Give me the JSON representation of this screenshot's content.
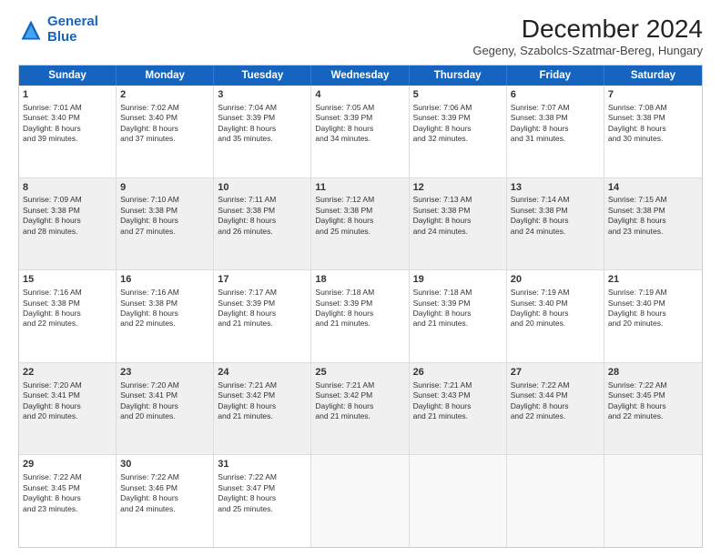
{
  "logo": {
    "line1": "General",
    "line2": "Blue"
  },
  "title": "December 2024",
  "subtitle": "Gegeny, Szabolcs-Szatmar-Bereg, Hungary",
  "header_days": [
    "Sunday",
    "Monday",
    "Tuesday",
    "Wednesday",
    "Thursday",
    "Friday",
    "Saturday"
  ],
  "rows": [
    [
      {
        "day": "1",
        "text": "Sunrise: 7:01 AM\nSunset: 3:40 PM\nDaylight: 8 hours\nand 39 minutes.",
        "shade": false
      },
      {
        "day": "2",
        "text": "Sunrise: 7:02 AM\nSunset: 3:40 PM\nDaylight: 8 hours\nand 37 minutes.",
        "shade": false
      },
      {
        "day": "3",
        "text": "Sunrise: 7:04 AM\nSunset: 3:39 PM\nDaylight: 8 hours\nand 35 minutes.",
        "shade": false
      },
      {
        "day": "4",
        "text": "Sunrise: 7:05 AM\nSunset: 3:39 PM\nDaylight: 8 hours\nand 34 minutes.",
        "shade": false
      },
      {
        "day": "5",
        "text": "Sunrise: 7:06 AM\nSunset: 3:39 PM\nDaylight: 8 hours\nand 32 minutes.",
        "shade": false
      },
      {
        "day": "6",
        "text": "Sunrise: 7:07 AM\nSunset: 3:38 PM\nDaylight: 8 hours\nand 31 minutes.",
        "shade": false
      },
      {
        "day": "7",
        "text": "Sunrise: 7:08 AM\nSunset: 3:38 PM\nDaylight: 8 hours\nand 30 minutes.",
        "shade": false
      }
    ],
    [
      {
        "day": "8",
        "text": "Sunrise: 7:09 AM\nSunset: 3:38 PM\nDaylight: 8 hours\nand 28 minutes.",
        "shade": true
      },
      {
        "day": "9",
        "text": "Sunrise: 7:10 AM\nSunset: 3:38 PM\nDaylight: 8 hours\nand 27 minutes.",
        "shade": true
      },
      {
        "day": "10",
        "text": "Sunrise: 7:11 AM\nSunset: 3:38 PM\nDaylight: 8 hours\nand 26 minutes.",
        "shade": true
      },
      {
        "day": "11",
        "text": "Sunrise: 7:12 AM\nSunset: 3:38 PM\nDaylight: 8 hours\nand 25 minutes.",
        "shade": true
      },
      {
        "day": "12",
        "text": "Sunrise: 7:13 AM\nSunset: 3:38 PM\nDaylight: 8 hours\nand 24 minutes.",
        "shade": true
      },
      {
        "day": "13",
        "text": "Sunrise: 7:14 AM\nSunset: 3:38 PM\nDaylight: 8 hours\nand 24 minutes.",
        "shade": true
      },
      {
        "day": "14",
        "text": "Sunrise: 7:15 AM\nSunset: 3:38 PM\nDaylight: 8 hours\nand 23 minutes.",
        "shade": true
      }
    ],
    [
      {
        "day": "15",
        "text": "Sunrise: 7:16 AM\nSunset: 3:38 PM\nDaylight: 8 hours\nand 22 minutes.",
        "shade": false
      },
      {
        "day": "16",
        "text": "Sunrise: 7:16 AM\nSunset: 3:38 PM\nDaylight: 8 hours\nand 22 minutes.",
        "shade": false
      },
      {
        "day": "17",
        "text": "Sunrise: 7:17 AM\nSunset: 3:39 PM\nDaylight: 8 hours\nand 21 minutes.",
        "shade": false
      },
      {
        "day": "18",
        "text": "Sunrise: 7:18 AM\nSunset: 3:39 PM\nDaylight: 8 hours\nand 21 minutes.",
        "shade": false
      },
      {
        "day": "19",
        "text": "Sunrise: 7:18 AM\nSunset: 3:39 PM\nDaylight: 8 hours\nand 21 minutes.",
        "shade": false
      },
      {
        "day": "20",
        "text": "Sunrise: 7:19 AM\nSunset: 3:40 PM\nDaylight: 8 hours\nand 20 minutes.",
        "shade": false
      },
      {
        "day": "21",
        "text": "Sunrise: 7:19 AM\nSunset: 3:40 PM\nDaylight: 8 hours\nand 20 minutes.",
        "shade": false
      }
    ],
    [
      {
        "day": "22",
        "text": "Sunrise: 7:20 AM\nSunset: 3:41 PM\nDaylight: 8 hours\nand 20 minutes.",
        "shade": true
      },
      {
        "day": "23",
        "text": "Sunrise: 7:20 AM\nSunset: 3:41 PM\nDaylight: 8 hours\nand 20 minutes.",
        "shade": true
      },
      {
        "day": "24",
        "text": "Sunrise: 7:21 AM\nSunset: 3:42 PM\nDaylight: 8 hours\nand 21 minutes.",
        "shade": true
      },
      {
        "day": "25",
        "text": "Sunrise: 7:21 AM\nSunset: 3:42 PM\nDaylight: 8 hours\nand 21 minutes.",
        "shade": true
      },
      {
        "day": "26",
        "text": "Sunrise: 7:21 AM\nSunset: 3:43 PM\nDaylight: 8 hours\nand 21 minutes.",
        "shade": true
      },
      {
        "day": "27",
        "text": "Sunrise: 7:22 AM\nSunset: 3:44 PM\nDaylight: 8 hours\nand 22 minutes.",
        "shade": true
      },
      {
        "day": "28",
        "text": "Sunrise: 7:22 AM\nSunset: 3:45 PM\nDaylight: 8 hours\nand 22 minutes.",
        "shade": true
      }
    ],
    [
      {
        "day": "29",
        "text": "Sunrise: 7:22 AM\nSunset: 3:45 PM\nDaylight: 8 hours\nand 23 minutes.",
        "shade": false
      },
      {
        "day": "30",
        "text": "Sunrise: 7:22 AM\nSunset: 3:46 PM\nDaylight: 8 hours\nand 24 minutes.",
        "shade": false
      },
      {
        "day": "31",
        "text": "Sunrise: 7:22 AM\nSunset: 3:47 PM\nDaylight: 8 hours\nand 25 minutes.",
        "shade": false
      },
      {
        "day": "",
        "text": "",
        "shade": false
      },
      {
        "day": "",
        "text": "",
        "shade": false
      },
      {
        "day": "",
        "text": "",
        "shade": false
      },
      {
        "day": "",
        "text": "",
        "shade": false
      }
    ]
  ]
}
